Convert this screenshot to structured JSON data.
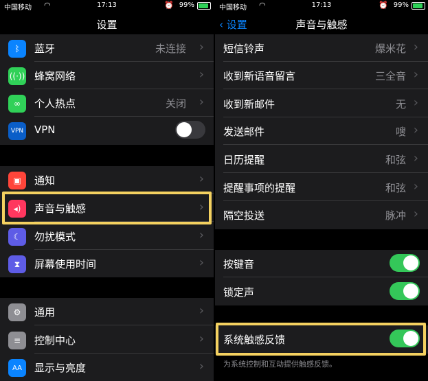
{
  "status_bar": {
    "carrier": "中国移动",
    "time": "17:13",
    "battery": "99%"
  },
  "left": {
    "title": "设置",
    "groups": [
      {
        "items": [
          {
            "label": "蓝牙",
            "value": "未连接",
            "icon": "bluetooth-icon",
            "icon_color": "#0a84ff"
          },
          {
            "label": "蜂窝网络",
            "value": "",
            "icon": "cellular-antenna-icon",
            "icon_color": "#30d158"
          },
          {
            "label": "个人热点",
            "value": "关闭",
            "icon": "hotspot-link-icon",
            "icon_color": "#30d158"
          },
          {
            "label": "VPN",
            "value": "",
            "icon": "vpn-icon",
            "icon_color": "#0a5ec8",
            "icon_text": "VPN",
            "toggle": false
          }
        ]
      },
      {
        "items": [
          {
            "label": "通知",
            "value": "",
            "icon": "notification-icon",
            "icon_color": "#ff453a"
          },
          {
            "label": "声音与触感",
            "value": "",
            "icon": "speaker-icon",
            "icon_color": "#ff375f"
          },
          {
            "label": "勿扰模式",
            "value": "",
            "icon": "moon-icon",
            "icon_color": "#5e5ce6"
          },
          {
            "label": "屏幕使用时间",
            "value": "",
            "icon": "hourglass-icon",
            "icon_color": "#5e5ce6"
          }
        ]
      },
      {
        "items": [
          {
            "label": "通用",
            "value": "",
            "icon": "gear-icon",
            "icon_color": "#8e8e93"
          },
          {
            "label": "控制中心",
            "value": "",
            "icon": "switches-icon",
            "icon_color": "#8e8e93"
          },
          {
            "label": "显示与亮度",
            "value": "",
            "icon": "text-size-icon",
            "icon_color": "#0a84ff",
            "icon_text": "AA"
          }
        ]
      }
    ]
  },
  "right": {
    "back_label": "设置",
    "title": "声音与触感",
    "groups": [
      {
        "items": [
          {
            "label": "短信铃声",
            "value": "爆米花"
          },
          {
            "label": "收到新语音留言",
            "value": "三全音"
          },
          {
            "label": "收到新邮件",
            "value": "无"
          },
          {
            "label": "发送邮件",
            "value": "嗖"
          },
          {
            "label": "日历提醒",
            "value": "和弦"
          },
          {
            "label": "提醒事项的提醒",
            "value": "和弦"
          },
          {
            "label": "隔空投送",
            "value": "脉冲"
          }
        ]
      },
      {
        "items": [
          {
            "label": "按键音",
            "toggle": true
          },
          {
            "label": "锁定声",
            "toggle": true
          }
        ]
      },
      {
        "items": [
          {
            "label": "系统触感反馈",
            "toggle": true
          }
        ],
        "footer": "为系统控制和互动提供触感反馈。"
      }
    ]
  },
  "colors": {
    "highlight": "#f4d160",
    "toggle_on": "#34c759",
    "accent": "#0a84ff"
  }
}
